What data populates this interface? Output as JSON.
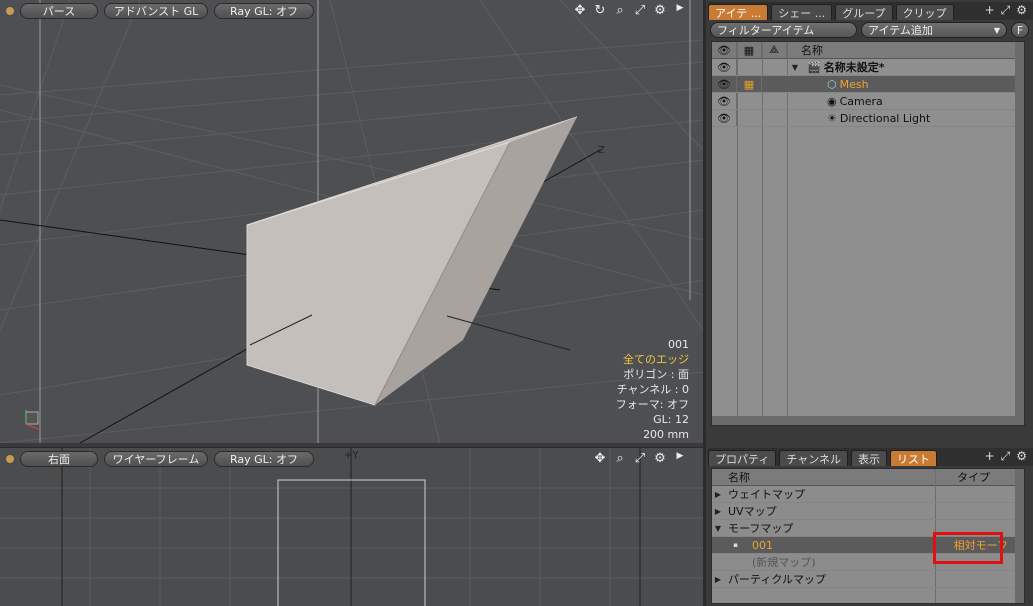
{
  "viewport_top": {
    "buttons": [
      "パース",
      "アドバンスト GL",
      "Ray GL: オフ"
    ],
    "info": {
      "map": "001",
      "edges": "全てのエッジ",
      "polygon": "ポリゴン : 面",
      "channel": "チャンネル : 0",
      "former": "フォーマ: オフ",
      "gl": "GL: 12",
      "size": "200 mm"
    },
    "axis_label": "Z",
    "colors": {
      "accent": "#f0c840",
      "background": "#4d4f52"
    }
  },
  "viewport_bottom": {
    "buttons": [
      "右面",
      "ワイヤーフレーム",
      "Ray GL: オフ"
    ],
    "axis_label": "+Y"
  },
  "items_panel": {
    "tabs": [
      "アイテ ...",
      "シェー ...",
      "グループ",
      "クリップ"
    ],
    "filter_label": "フィルターアイテム",
    "add_label": "アイテム追加",
    "f_label": "F",
    "header_name": "名称",
    "scene_name": "名称未設定*",
    "items": [
      {
        "label": "Mesh",
        "icon": "mesh-icon",
        "selected": true
      },
      {
        "label": "Camera",
        "icon": "camera-icon",
        "selected": false
      },
      {
        "label": "Directional Light",
        "icon": "light-icon",
        "selected": false
      }
    ]
  },
  "list_panel": {
    "tabs": [
      "プロパティ",
      "チャンネル",
      "表示",
      "リスト"
    ],
    "header_name": "名称",
    "header_type": "タイプ",
    "rows": [
      {
        "label": "ウェイトマップ",
        "type": ""
      },
      {
        "label": "UVマップ",
        "type": ""
      },
      {
        "label": "モーフマップ",
        "type": ""
      },
      {
        "label": "001",
        "type": "相対モーフ"
      },
      {
        "label": "(新規マップ)",
        "type": ""
      },
      {
        "label": "パーティクルマップ",
        "type": ""
      }
    ]
  }
}
